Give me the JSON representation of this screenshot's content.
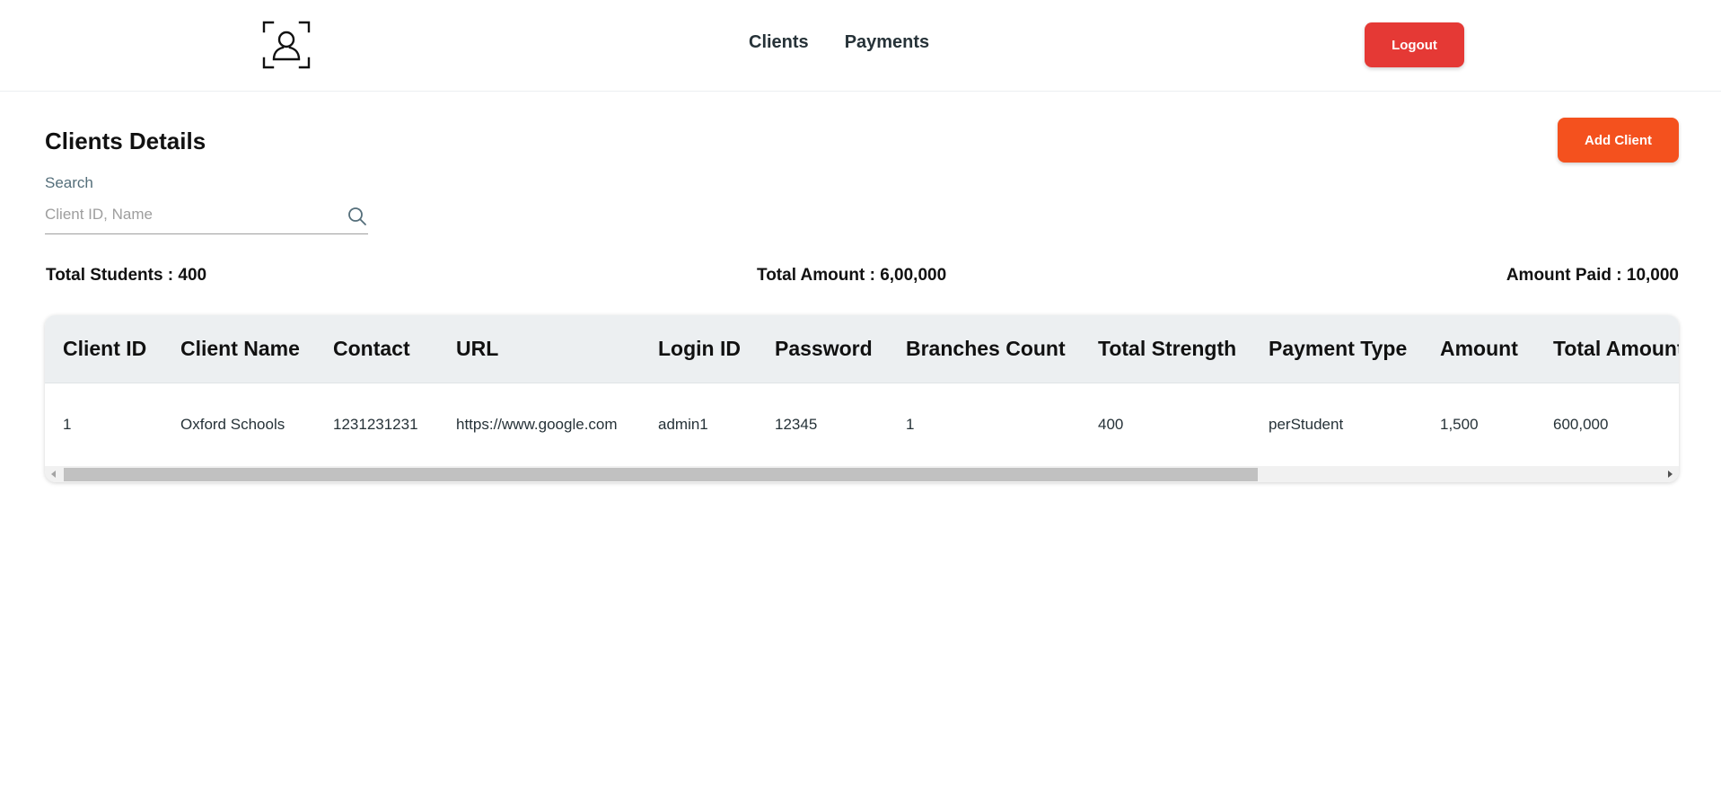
{
  "header": {
    "logo_icon": "user-focus-icon",
    "nav": [
      {
        "label": "Clients"
      },
      {
        "label": "Payments"
      }
    ],
    "logout_label": "Logout",
    "colors": {
      "logout": "#e53935"
    }
  },
  "page": {
    "title": "Clients Details",
    "add_client_label": "Add Client",
    "colors": {
      "add_client": "#f4511e"
    }
  },
  "search": {
    "label": "Search",
    "placeholder": "Client ID, Name",
    "value": "",
    "icon": "search-icon"
  },
  "totals": {
    "students": "Total Students : 400",
    "amount": "Total Amount : 6,00,000",
    "paid": "Amount Paid : 10,000"
  },
  "table": {
    "columns": [
      "Client ID",
      "Client Name",
      "Contact",
      "URL",
      "Login ID",
      "Password",
      "Branches Count",
      "Total Strength",
      "Payment Type",
      "Amount",
      "Total Amount"
    ],
    "rows": [
      [
        "1",
        "Oxford Schools",
        "1231231231",
        "https://www.google.com",
        "admin1",
        "12345",
        "1",
        "400",
        "perStudent",
        "1,500",
        "600,000"
      ]
    ]
  }
}
